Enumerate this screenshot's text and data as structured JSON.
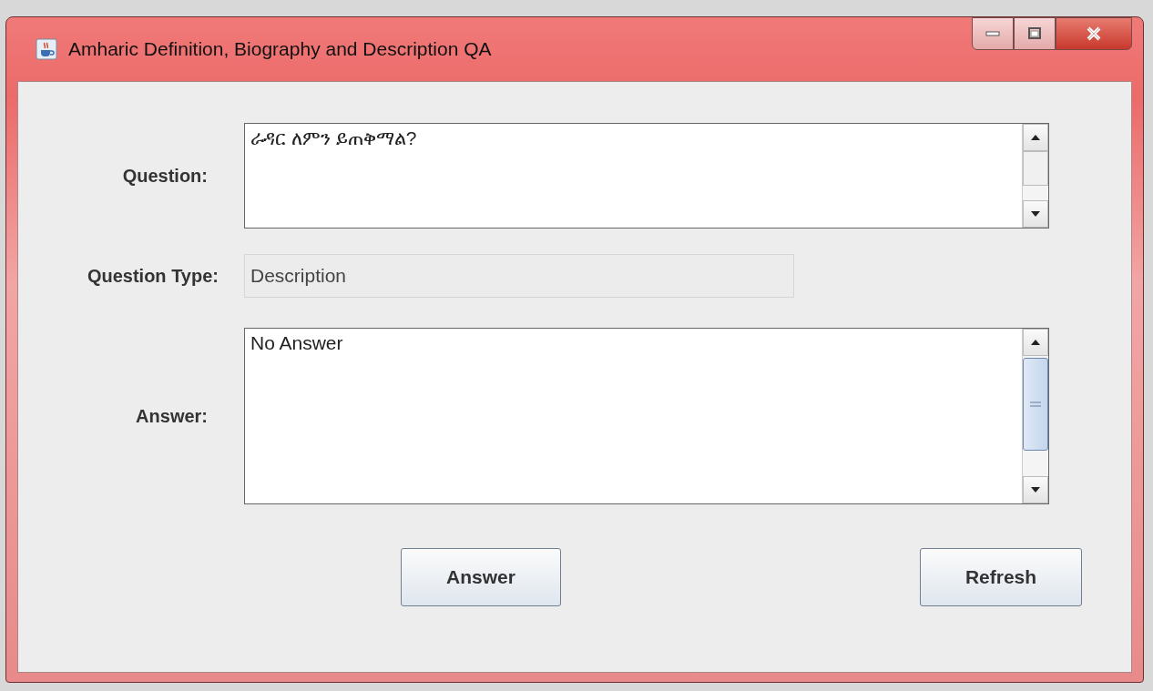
{
  "window": {
    "title": "Amharic Definition, Biography and Description QA"
  },
  "fields": [
    {
      "kind": "textarea",
      "label": "Question:",
      "value": "ራዳር ለምን ይጠቅማል?"
    },
    {
      "kind": "readonly",
      "label": "Question Type:",
      "value": "Description"
    },
    {
      "kind": "textarea",
      "label": "Answer:",
      "value": "No Answer"
    }
  ],
  "buttons": [
    "Answer",
    "Refresh"
  ]
}
